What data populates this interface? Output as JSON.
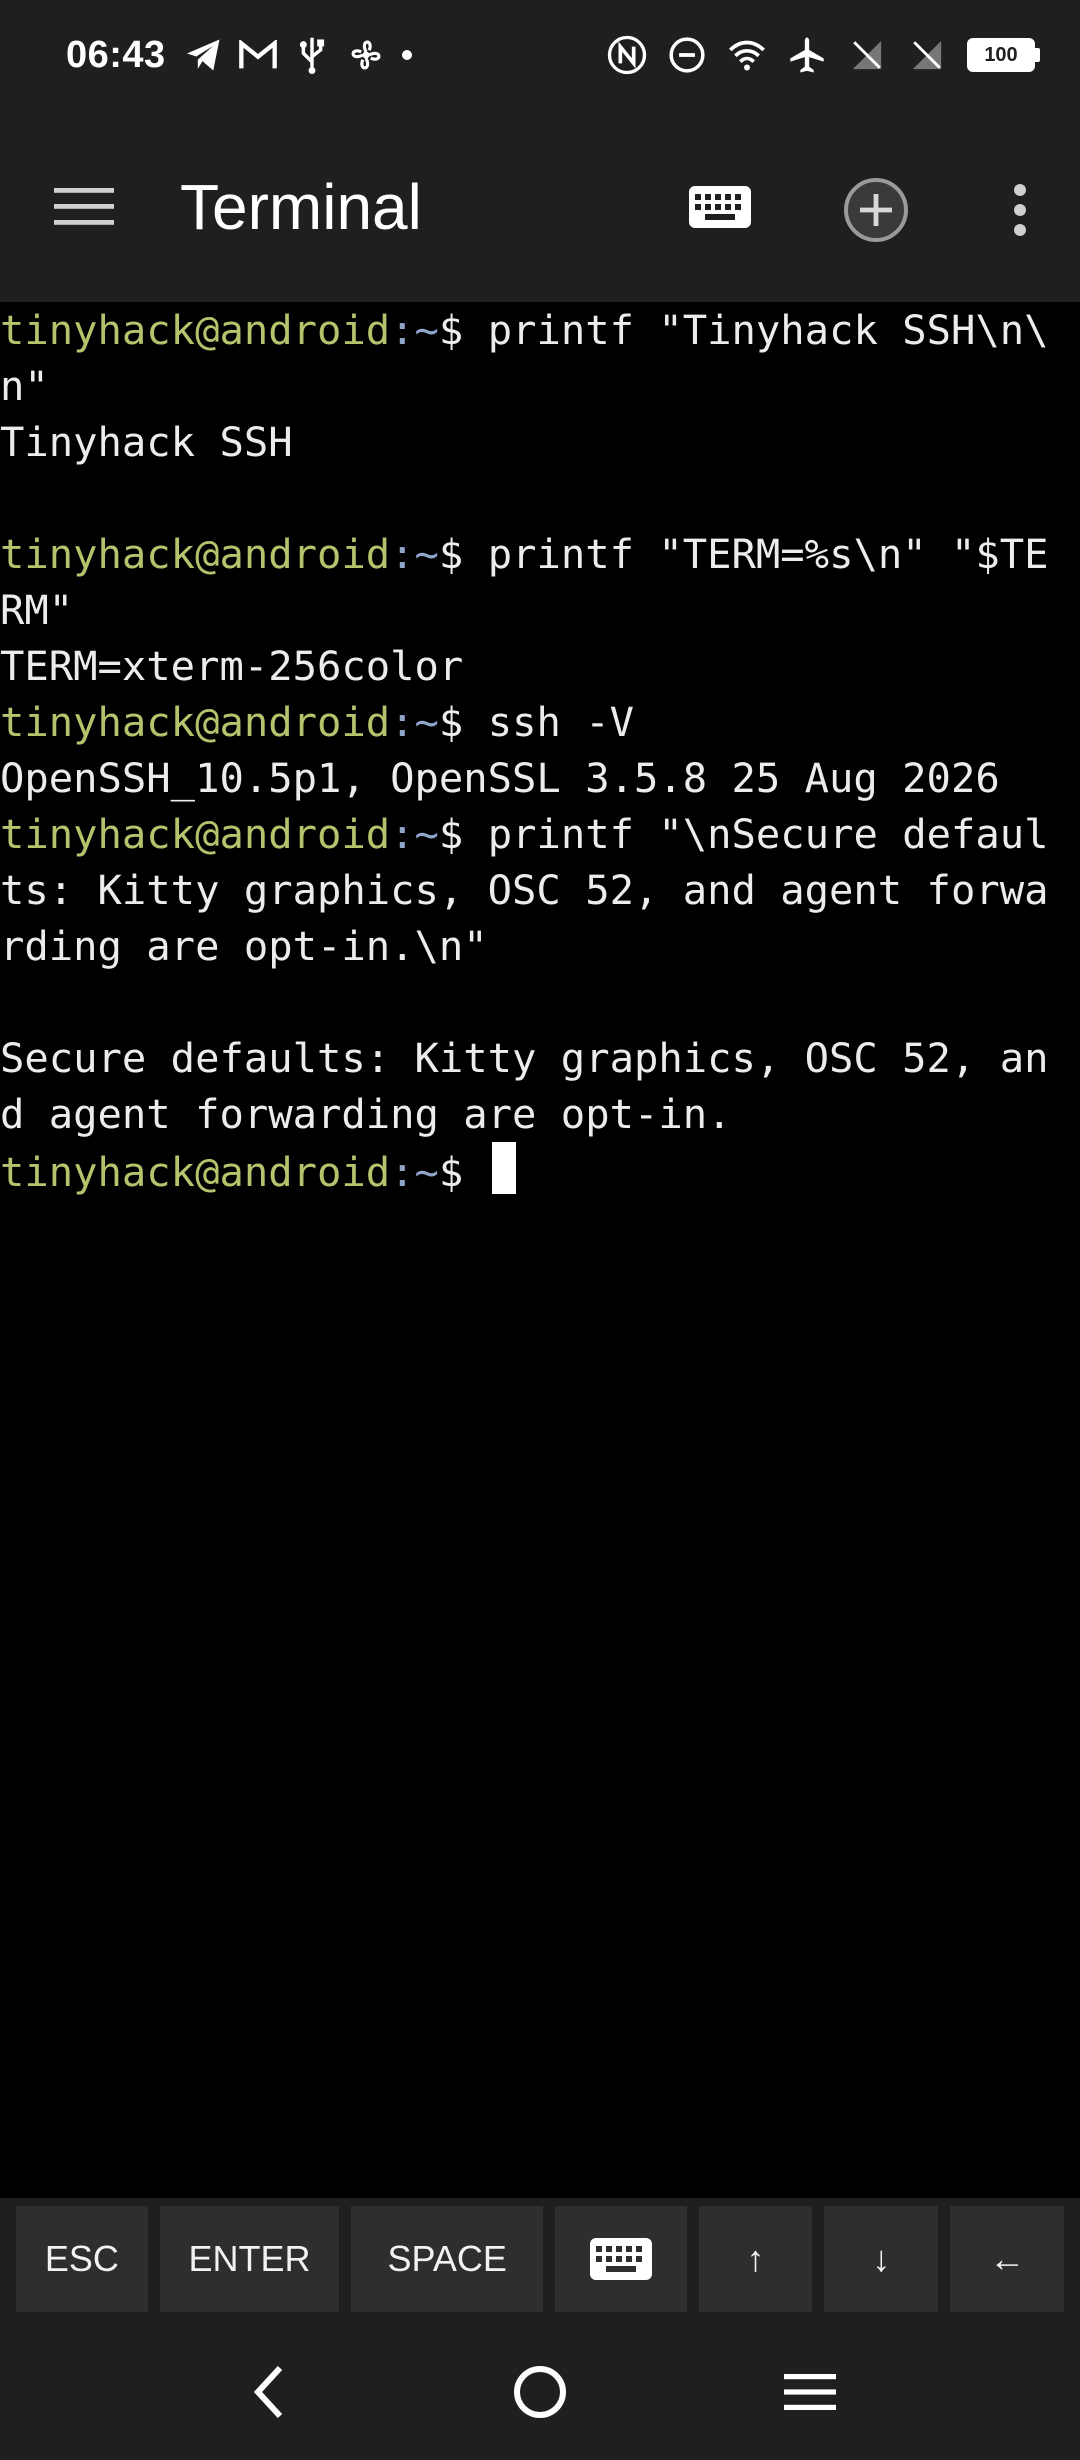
{
  "status_bar": {
    "time": "06:43",
    "left_icons": [
      "telegram-icon",
      "gmail-icon",
      "usb-icon",
      "fan-icon",
      "dot-icon"
    ],
    "right_icons": [
      "nfc-icon",
      "dnd-icon",
      "wifi-icon",
      "airplane-icon",
      "no-sim-icon",
      "no-sim-icon"
    ],
    "battery": "100"
  },
  "app_bar": {
    "title": "Terminal"
  },
  "terminal": {
    "prompt_user": "tinyhack@android",
    "prompt_path": ":~",
    "prompt_symbol": "$ ",
    "lines": [
      {
        "type": "prompt",
        "text": "printf \"Tinyhack SSH\\n\\"
      },
      {
        "type": "output",
        "text": "n\""
      },
      {
        "type": "output",
        "text": "Tinyhack SSH"
      },
      {
        "type": "output",
        "text": ""
      },
      {
        "type": "prompt",
        "text": "printf \"TERM=%s\\n\" \"$TE"
      },
      {
        "type": "output",
        "text": "RM\""
      },
      {
        "type": "output",
        "text": "TERM=xterm-256color"
      },
      {
        "type": "prompt",
        "text": "ssh -V"
      },
      {
        "type": "output",
        "text": "OpenSSH_10.5p1, OpenSSL 3.5.8 25 Aug 2026"
      },
      {
        "type": "prompt",
        "text": "printf \"\\nSecure defaul"
      },
      {
        "type": "output",
        "text": "ts: Kitty graphics, OSC 52, and agent forwa"
      },
      {
        "type": "output",
        "text": "rding are opt-in.\\n\""
      },
      {
        "type": "output",
        "text": ""
      },
      {
        "type": "output",
        "text": "Secure defaults: Kitty graphics, OSC 52, an"
      },
      {
        "type": "output",
        "text": "d agent forwarding are opt-in."
      },
      {
        "type": "prompt-cursor",
        "text": ""
      }
    ]
  },
  "extra_keys": {
    "esc": "ESC",
    "enter": "ENTER",
    "space": "SPACE",
    "up": "↑",
    "down": "↓",
    "left": "←"
  },
  "colors": {
    "prompt_user": "#b5c46c",
    "prompt_path": "#8fa5c9",
    "bar_bg": "#1f1f1f",
    "key_bg": "#2e2e2e"
  }
}
